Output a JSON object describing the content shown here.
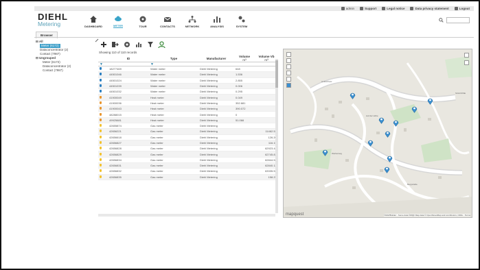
{
  "topbar": {
    "links": [
      {
        "label": "admin",
        "icon": "user-icon"
      },
      {
        "label": "Support",
        "icon": "support-icon"
      },
      {
        "label": "Legal notice",
        "icon": "legal-icon"
      },
      {
        "label": "Data privacy statement",
        "icon": "privacy-icon"
      },
      {
        "label": "Logout",
        "icon": "logout-icon"
      }
    ]
  },
  "logo": {
    "main": "DIEHL",
    "sub": "Metering"
  },
  "nav": [
    {
      "label": "DASHBOARD",
      "icon": "home-icon"
    },
    {
      "label": "METER",
      "icon": "meter-icon",
      "active": true
    },
    {
      "label": "TOUR",
      "icon": "tour-icon"
    },
    {
      "label": "CONTACTS",
      "icon": "mail-icon"
    },
    {
      "label": "NETWORK",
      "icon": "network-icon"
    },
    {
      "label": "ANALYSIS",
      "icon": "analysis-icon"
    },
    {
      "label": "SYSTEM",
      "icon": "system-icon"
    }
  ],
  "tabs": {
    "browser": "Browser"
  },
  "tree": {
    "all": "All",
    "meter": "Meter (6172)",
    "datacon": "Dataconcentrator (2)",
    "contact": "Contact (7987)",
    "ungrouped": "Ungrouped",
    "meter2": "Meter (6172)",
    "datacon2": "Dataconcentrator (2)",
    "contact2": "Contact (7987)"
  },
  "list": {
    "showing": "Showing 110 of 110 records",
    "columns": {
      "id": "ID",
      "type": "Type",
      "manufacturer": "Manufacturer",
      "volume": "Volume",
      "volume_unit": "m³",
      "volume_vb": "Volume Vb",
      "volume_vb_unit": "m³"
    },
    "rows": [
      {
        "id": "18277469",
        "type": "Water meter",
        "manufacturer": "Diehl Metering",
        "volume": "648",
        "volume_vb": "",
        "color": "#2b7fc1"
      },
      {
        "id": "44501046",
        "type": "Water meter",
        "manufacturer": "Diehl Metering",
        "volume": "1.536",
        "volume_vb": "",
        "color": "#2b7fc1"
      },
      {
        "id": "44501024",
        "type": "Water meter",
        "manufacturer": "Diehl Metering",
        "volume": "2.855",
        "volume_vb": "",
        "color": "#2b7fc1"
      },
      {
        "id": "44501039",
        "type": "Water meter",
        "manufacturer": "Diehl Metering",
        "volume": "0.006",
        "volume_vb": "",
        "color": "#2b7fc1"
      },
      {
        "id": "44501032",
        "type": "Water meter",
        "manufacturer": "Diehl Metering",
        "volume": "0.295",
        "volume_vb": "",
        "color": "#2b7fc1"
      },
      {
        "id": "41900049",
        "type": "Heat meter",
        "manufacturer": "Diehl Metering",
        "volume": "0.049",
        "volume_vb": "",
        "color": "#e8962f"
      },
      {
        "id": "41900036",
        "type": "Heat meter",
        "manufacturer": "Diehl Metering",
        "volume": "352.881",
        "volume_vb": "",
        "color": "#e8962f"
      },
      {
        "id": "41900043",
        "type": "Heat meter",
        "manufacturer": "Diehl Metering",
        "volume": "390.072",
        "volume_vb": "",
        "color": "#e8962f"
      },
      {
        "id": "48288015",
        "type": "Heat meter",
        "manufacturer": "Diehl Metering",
        "volume": "0",
        "volume_vb": "",
        "color": "#e8962f"
      },
      {
        "id": "49925681",
        "type": "Heat meter",
        "manufacturer": "Diehl Metering",
        "volume": "51.066",
        "volume_vb": "",
        "color": "#e8962f"
      },
      {
        "id": "42655874",
        "type": "Gas meter",
        "manufacturer": "Diehl Metering",
        "volume": "",
        "volume_vb": "",
        "color": "#f2c230"
      },
      {
        "id": "42656221",
        "type": "Gas meter",
        "manufacturer": "Diehl Metering",
        "volume": "",
        "volume_vb": "11462.536",
        "color": "#f2c230"
      },
      {
        "id": "42656618",
        "type": "Gas meter",
        "manufacturer": "Diehl Metering",
        "volume": "",
        "volume_vb": "126.209",
        "color": "#f2c230"
      },
      {
        "id": "42656827",
        "type": "Gas meter",
        "manufacturer": "Diehl Metering",
        "volume": "",
        "volume_vb": "116.155",
        "color": "#f2c230"
      },
      {
        "id": "42656828",
        "type": "Gas meter",
        "manufacturer": "Diehl Metering",
        "volume": "",
        "volume_vb": "62923.442",
        "color": "#f2c230"
      },
      {
        "id": "42656829",
        "type": "Gas meter",
        "manufacturer": "Diehl Metering",
        "volume": "",
        "volume_vb": "62745.839",
        "color": "#f2c230"
      },
      {
        "id": "42656834",
        "type": "Gas meter",
        "manufacturer": "Diehl Metering",
        "volume": "",
        "volume_vb": "62844.521",
        "color": "#f2c230"
      },
      {
        "id": "42656831",
        "type": "Gas meter",
        "manufacturer": "Diehl Metering",
        "volume": "",
        "volume_vb": "62840.127",
        "color": "#f2c230"
      },
      {
        "id": "42656832",
        "type": "Gas meter",
        "manufacturer": "Diehl Metering",
        "volume": "",
        "volume_vb": "63335.533",
        "color": "#f2c230"
      },
      {
        "id": "42656835",
        "type": "Gas meter",
        "manufacturer": "Diehl Metering",
        "volume": "",
        "volume_vb": "158.256",
        "color": "#f2c230"
      }
    ]
  },
  "map": {
    "logo": "mapquest",
    "attribution": "©MAPBuilder  ·  Some data ©MQF  Map data © OpenStreetMap and contributors, ODbL  ·  Terms",
    "labels": [
      "Im Eichholz",
      "Auf der Höhe",
      "Weiherweg",
      "Bergstraße",
      "SCHOOSE"
    ],
    "pin_color": "#3a8fd0"
  },
  "colors": {
    "accent": "#3aa4c9",
    "selected": "#3c9ec8",
    "water": "#2b7fc1",
    "heat": "#e8962f",
    "gas": "#f2c230"
  }
}
